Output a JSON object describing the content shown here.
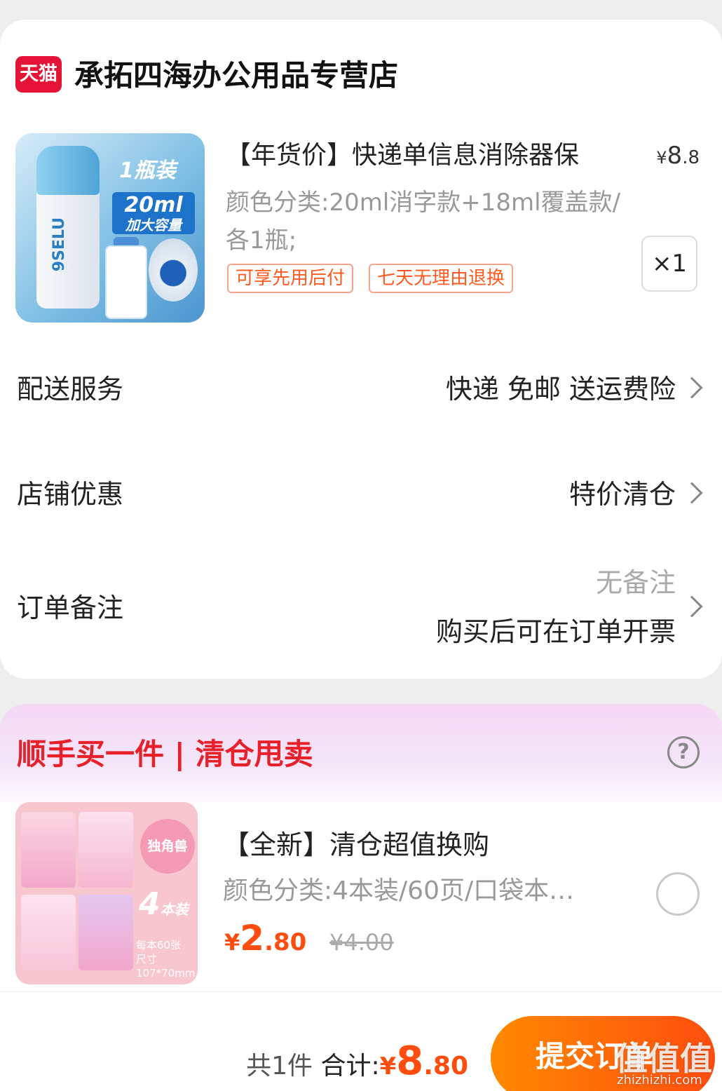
{
  "store": {
    "logo_text": "天猫",
    "name": "承拓四海办公用品专营店"
  },
  "product": {
    "title": "【年货价】快递单信息消除器保",
    "price_symbol": "¥",
    "price_int": "8",
    "price_dec": ".8",
    "spec": "颜色分类:20ml消字款+18ml覆盖款/各1瓶;",
    "quantity": "×1",
    "badges": [
      "可享先用后付",
      "七天无理由退换"
    ],
    "image_text": {
      "pack": "1瓶装",
      "volume": "20ml",
      "capacity": "加大容量",
      "brand": "9SELU"
    }
  },
  "rows": {
    "delivery_label": "配送服务",
    "delivery_value": "快递 免邮 送运费险",
    "coupon_label": "店铺优惠",
    "coupon_value": "特价清仓",
    "note_label": "订单备注",
    "note_value": "无备注",
    "note_sub": "购买后可在订单开票"
  },
  "promo": {
    "title": "顺手买一件 | 清仓甩卖",
    "help_icon": "?",
    "item_name": "【全新】清仓超值换购",
    "item_spec": "颜色分类:4本装/60页/口袋本…",
    "price_symbol": "¥",
    "price_int": "2",
    "price_dec": ".80",
    "old_price": "¥4.00",
    "image_text": {
      "badge": "独角兽",
      "count": "4",
      "unit": "本装",
      "info1": "每本60张",
      "info2": "尺寸107*70mm"
    }
  },
  "footer": {
    "count": "共1件",
    "total_label": "合计:",
    "total_symbol": "¥",
    "total_int": "8",
    "total_dec": ".80",
    "submit_label": "提交订单",
    "watermark": "值值值",
    "watermark_url": "zhizhizhi.com"
  },
  "colors": {
    "accent": "#ff4d0f",
    "brand_red": "#e31436",
    "promo_red": "#e8202a"
  }
}
